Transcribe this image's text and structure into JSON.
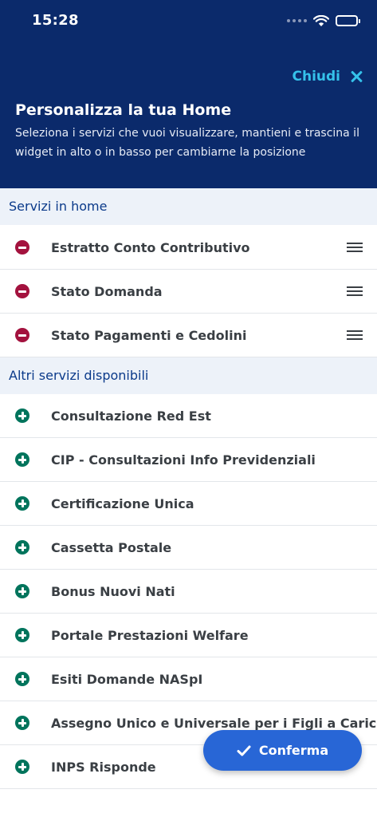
{
  "status_bar": {
    "time": "15:28"
  },
  "header": {
    "close_label": "Chiudi",
    "title": "Personalizza la tua Home",
    "subtitle": "Seleziona i servizi che vuoi visualizzare, mantieni e trascina il widget in alto o in basso per cambiarne la posizione"
  },
  "home_services": {
    "heading": "Servizi in home",
    "items": [
      {
        "label": "Estratto Conto Contributivo",
        "icon": "minus-circle-icon"
      },
      {
        "label": "Stato Domanda",
        "icon": "minus-circle-icon"
      },
      {
        "label": "Stato Pagamenti e Cedolini",
        "icon": "minus-circle-icon"
      }
    ]
  },
  "other_services": {
    "heading": "Altri servizi disponibili",
    "items": [
      {
        "label": "Consultazione Red Est",
        "icon": "plus-circle-icon"
      },
      {
        "label": "CIP - Consultazioni Info Previdenziali",
        "icon": "plus-circle-icon"
      },
      {
        "label": "Certificazione Unica",
        "icon": "plus-circle-icon"
      },
      {
        "label": "Cassetta Postale",
        "icon": "plus-circle-icon"
      },
      {
        "label": "Bonus Nuovi Nati",
        "icon": "plus-circle-icon"
      },
      {
        "label": "Portale Prestazioni Welfare",
        "icon": "plus-circle-icon"
      },
      {
        "label": "Esiti Domande NASpI",
        "icon": "plus-circle-icon"
      },
      {
        "label": "Assegno Unico e Universale per i Figli a Carico",
        "icon": "plus-circle-icon"
      },
      {
        "label": "INPS Risponde",
        "icon": "plus-circle-icon"
      }
    ]
  },
  "confirm_label": "Conferma",
  "colors": {
    "header_bg": "#0b2a6b",
    "accent": "#35c1ea",
    "remove": "#a3123e",
    "add": "#00745c",
    "primary_button": "#2866d6"
  }
}
